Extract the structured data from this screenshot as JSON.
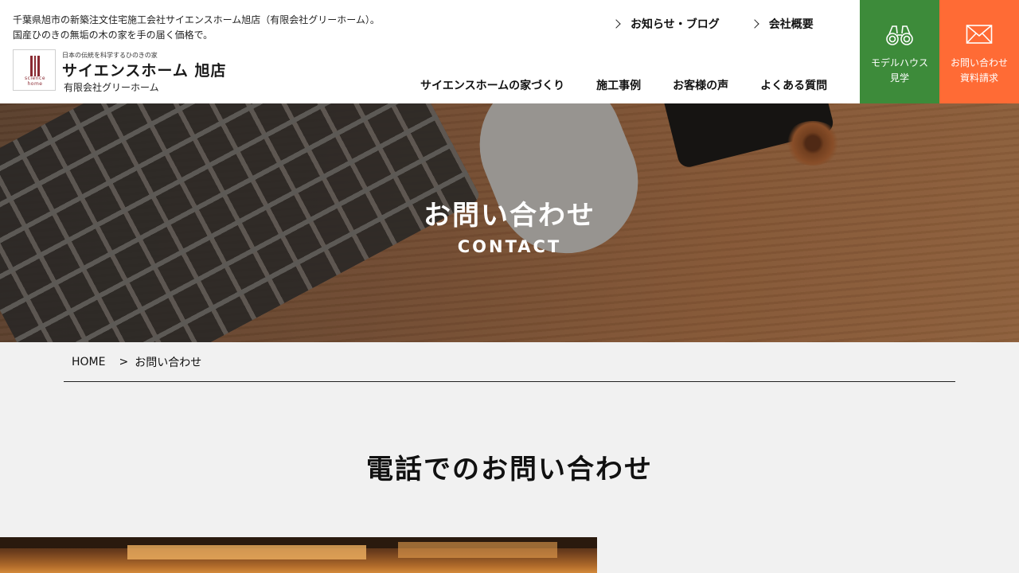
{
  "header": {
    "tagline_line1": "千葉県旭市の新築注文住宅施工会社サイエンスホーム旭店（有限会社グリーホーム）。",
    "tagline_line2": "国産ひのきの無垢の木の家を手の届く価格で。",
    "logo": {
      "small_text": "日本の伝統を科学するひのきの家",
      "brand": "サイエンスホーム 旭店",
      "company": "有限会社グリーホーム",
      "mark_text": "science home"
    },
    "top_links": [
      {
        "label": "お知らせ・ブログ"
      },
      {
        "label": "会社概要"
      }
    ],
    "nav": [
      {
        "label": "サイエンスホームの家づくり"
      },
      {
        "label": "施工事例"
      },
      {
        "label": "お客様の声"
      },
      {
        "label": "よくある質問"
      }
    ],
    "cta_model": {
      "line1": "モデルハウス",
      "line2": "見学",
      "icon": "binoculars-icon",
      "color": "#3d8b3a"
    },
    "cta_contact": {
      "line1": "お問い合わせ",
      "line2": "資料請求",
      "icon": "mail-icon",
      "color": "#ff6b35"
    }
  },
  "hero": {
    "title": "お問い合わせ",
    "subtitle": "CONTACT"
  },
  "breadcrumb": {
    "home": "HOME",
    "separator": ">",
    "current": "お問い合わせ"
  },
  "section": {
    "title": "電話でのお問い合わせ"
  }
}
